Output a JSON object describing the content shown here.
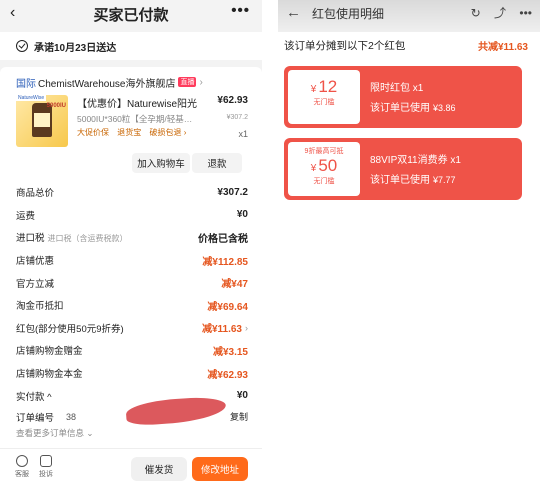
{
  "left": {
    "header": {
      "back_icon": "chevron-left",
      "title": "买家已付款",
      "more": "•••"
    },
    "promise": "承诺10月23日送达",
    "store": {
      "prefix": "国际",
      "name": "ChemistWarehouse海外旗舰店",
      "badge": "直播",
      "chevron": "›"
    },
    "product": {
      "thumb_tag": "NatureWise",
      "thumb_big": "5000IU",
      "name": "【优惠价】Naturewise阳光",
      "price": "¥62.93",
      "spec": "5000IU*360粒【全孕期/轻基…",
      "orig_price": "¥307.2",
      "tags": [
        "大促价保",
        "退货宝",
        "破损包退 ›"
      ],
      "qty": "x1"
    },
    "actions": {
      "cart": "加入购物车",
      "refund": "退款"
    },
    "rows": [
      {
        "label": "商品总价",
        "note": "",
        "value": "¥307.2",
        "orange": false,
        "chev": ""
      },
      {
        "label": "运费",
        "note": "",
        "value": "¥0",
        "orange": false,
        "chev": ""
      },
      {
        "label": "进口税",
        "note": "进口税（含运费税款）",
        "value": "价格已含税",
        "orange": false,
        "chev": ""
      },
      {
        "label": "店铺优惠",
        "note": "",
        "value": "减¥112.85",
        "orange": true,
        "chev": ""
      },
      {
        "label": "官方立减",
        "note": "",
        "value": "减¥47",
        "orange": true,
        "chev": ""
      },
      {
        "label": "淘金币抵扣",
        "note": "",
        "value": "减¥69.64",
        "orange": true,
        "chev": ""
      },
      {
        "label": "红包(部分使用50元9折券)",
        "note": "",
        "value": "减¥11.63",
        "orange": true,
        "chev": "›"
      },
      {
        "label": "店铺购物金赠金",
        "note": "",
        "value": "减¥3.15",
        "orange": true,
        "chev": ""
      },
      {
        "label": "店铺购物金本金",
        "note": "",
        "value": "减¥62.93",
        "orange": true,
        "chev": ""
      },
      {
        "label": "实付款 ^",
        "note": "",
        "value": "¥0",
        "orange": false,
        "chev": ""
      }
    ],
    "order": {
      "label": "订单编号",
      "number": "38",
      "copy": "复制",
      "more_info": "查看更多订单信息 ⌄"
    },
    "bottom": {
      "service": "客服",
      "complain": "投诉",
      "ship_btn": "催发货",
      "addr_btn": "修改地址"
    }
  },
  "right": {
    "header": {
      "back_icon": "arrow-left",
      "title": "红包使用明细",
      "icons": [
        "↻",
        "⤴",
        "•••"
      ]
    },
    "summary": {
      "text": "该订单分摊到以下2个红包",
      "total": "共减¥11.63"
    },
    "coupons": [
      {
        "top": "",
        "amount": "12",
        "threshold": "无门槛",
        "name": "限时红包 x1",
        "used_label": "该订单已使用",
        "used": "¥3.86"
      },
      {
        "top": "9折最高可抵",
        "amount": "50",
        "threshold": "无门槛",
        "name": "88VIP双11消费券 x1",
        "used_label": "该订单已使用",
        "used": "¥7.77"
      }
    ]
  }
}
